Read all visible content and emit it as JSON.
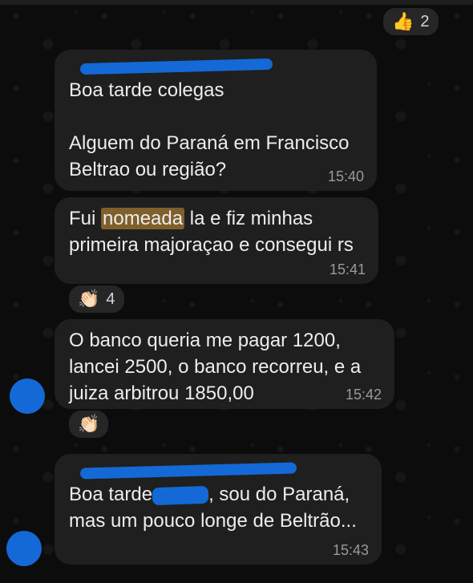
{
  "reactions": {
    "r1": {
      "emoji": "👍",
      "count": "2"
    },
    "r2": {
      "emoji": "👏🏻",
      "count": "4"
    },
    "r3": {
      "emoji": "👏🏻",
      "count": ""
    }
  },
  "messages": [
    {
      "lines": [
        "Boa tarde colegas",
        "",
        "Alguem do Paraná em Francisco",
        "Beltrao ou região?"
      ],
      "time": "15:40"
    },
    {
      "line1_pre": "Fui ",
      "line1_highlight": "nomeada",
      "line1_post": " la e fiz minhas",
      "line2": "primeira majoraçao e consegui rs",
      "time": "15:41"
    },
    {
      "lines": [
        "O banco queria me pagar 1200,",
        "lancei 2500, o banco recorreu, e a",
        "juiza arbitrou 1850,00"
      ],
      "time": "15:42"
    },
    {
      "line1_pre": "Boa tarde",
      "line1_post": ", sou do Paraná,",
      "line2": "mas um pouco longe de Beltrão...",
      "time": "15:43"
    }
  ]
}
